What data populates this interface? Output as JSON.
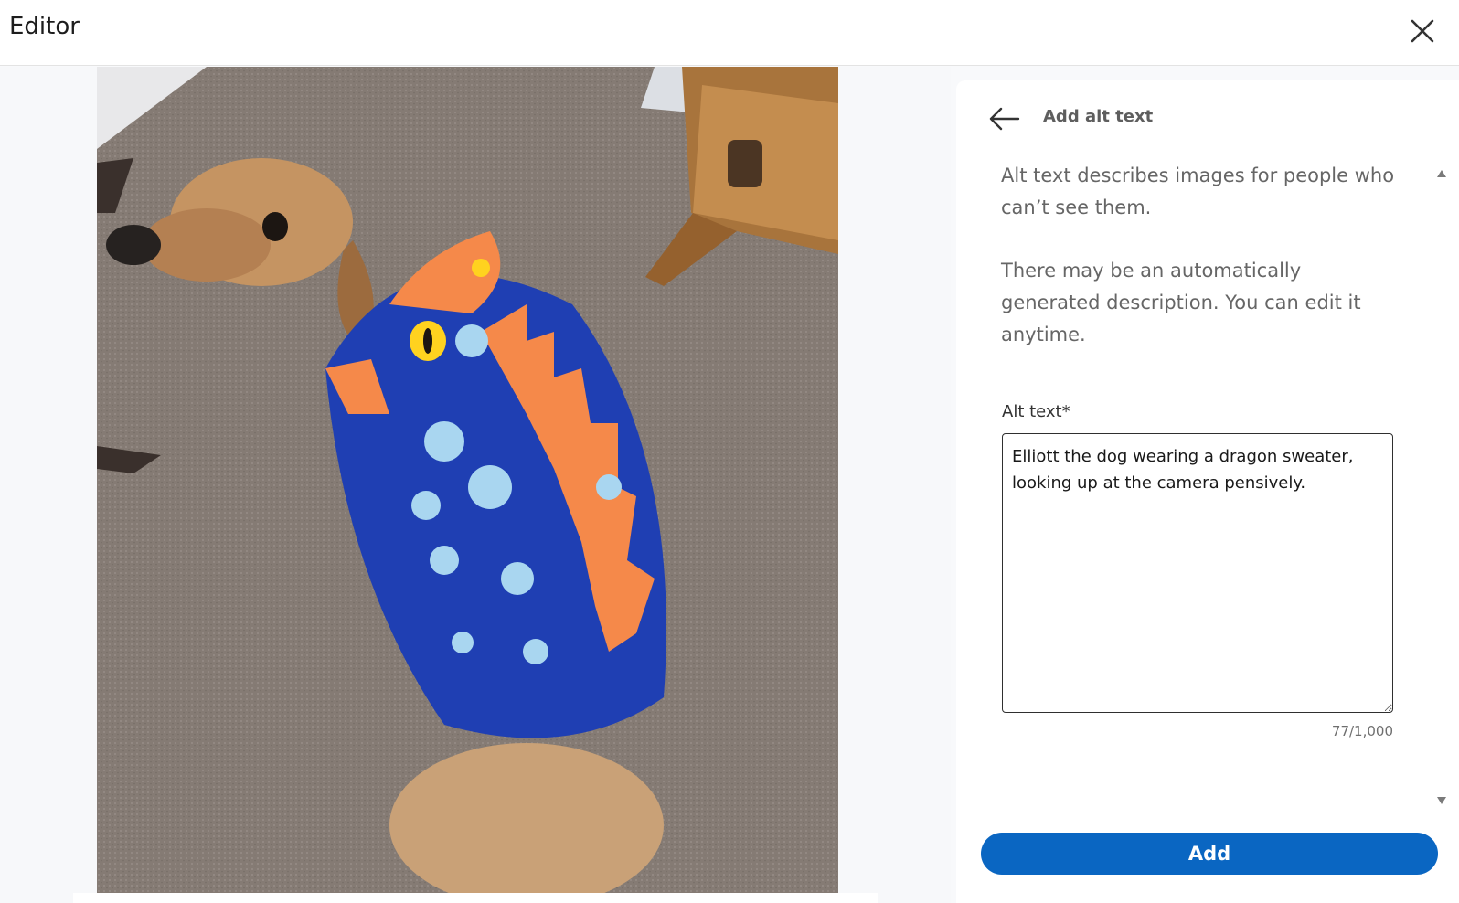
{
  "header": {
    "title": "Editor",
    "close_icon": "close-icon"
  },
  "photo": {
    "subject_icon": "dog-photo"
  },
  "panel": {
    "title": "Add alt text",
    "back_icon": "arrow-left-icon",
    "description_1": "Alt text describes images for people who can’t see them.",
    "description_2": "There may be an automatically generated description. You can edit it anytime.",
    "field_label": "Alt text*",
    "alt_text_value": "Elliott the dog wearing a dragon sweater, looking up at the camera pensively.",
    "counter": "77/1,000",
    "add_label": "Add"
  },
  "colors": {
    "accent": "#0a66c2",
    "sweater": "#1f3fb3",
    "spikes": "#f5894a"
  }
}
